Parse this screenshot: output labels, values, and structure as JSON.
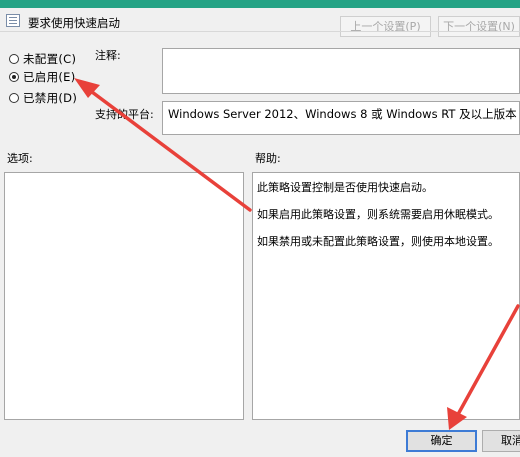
{
  "window": {
    "title": "要求使用快速启动"
  },
  "nav": {
    "prev_label": "上一个设置(P)",
    "next_label": "下一个设置(N)"
  },
  "state": {
    "options": [
      {
        "label": "未配置(C)",
        "checked": false
      },
      {
        "label": "已启用(E)",
        "checked": true
      },
      {
        "label": "已禁用(D)",
        "checked": false
      }
    ]
  },
  "comment": {
    "label": "注释:",
    "value": ""
  },
  "supported": {
    "label": "支持的平台:",
    "value": "Windows Server 2012、Windows 8 或 Windows RT 及以上版本"
  },
  "options_panel": {
    "label": "选项:"
  },
  "help_panel": {
    "label": "帮助:",
    "lines": [
      "此策略设置控制是否使用快速启动。",
      "如果启用此策略设置，则系统需要启用休眠模式。",
      "如果禁用或未配置此策略设置，则使用本地设置。"
    ]
  },
  "buttons": {
    "ok_label": "确定",
    "cancel_label": "取消"
  },
  "colors": {
    "title_bar": "#24a385",
    "arrow": "#e8413a",
    "ok_border": "#3d7bd5"
  }
}
